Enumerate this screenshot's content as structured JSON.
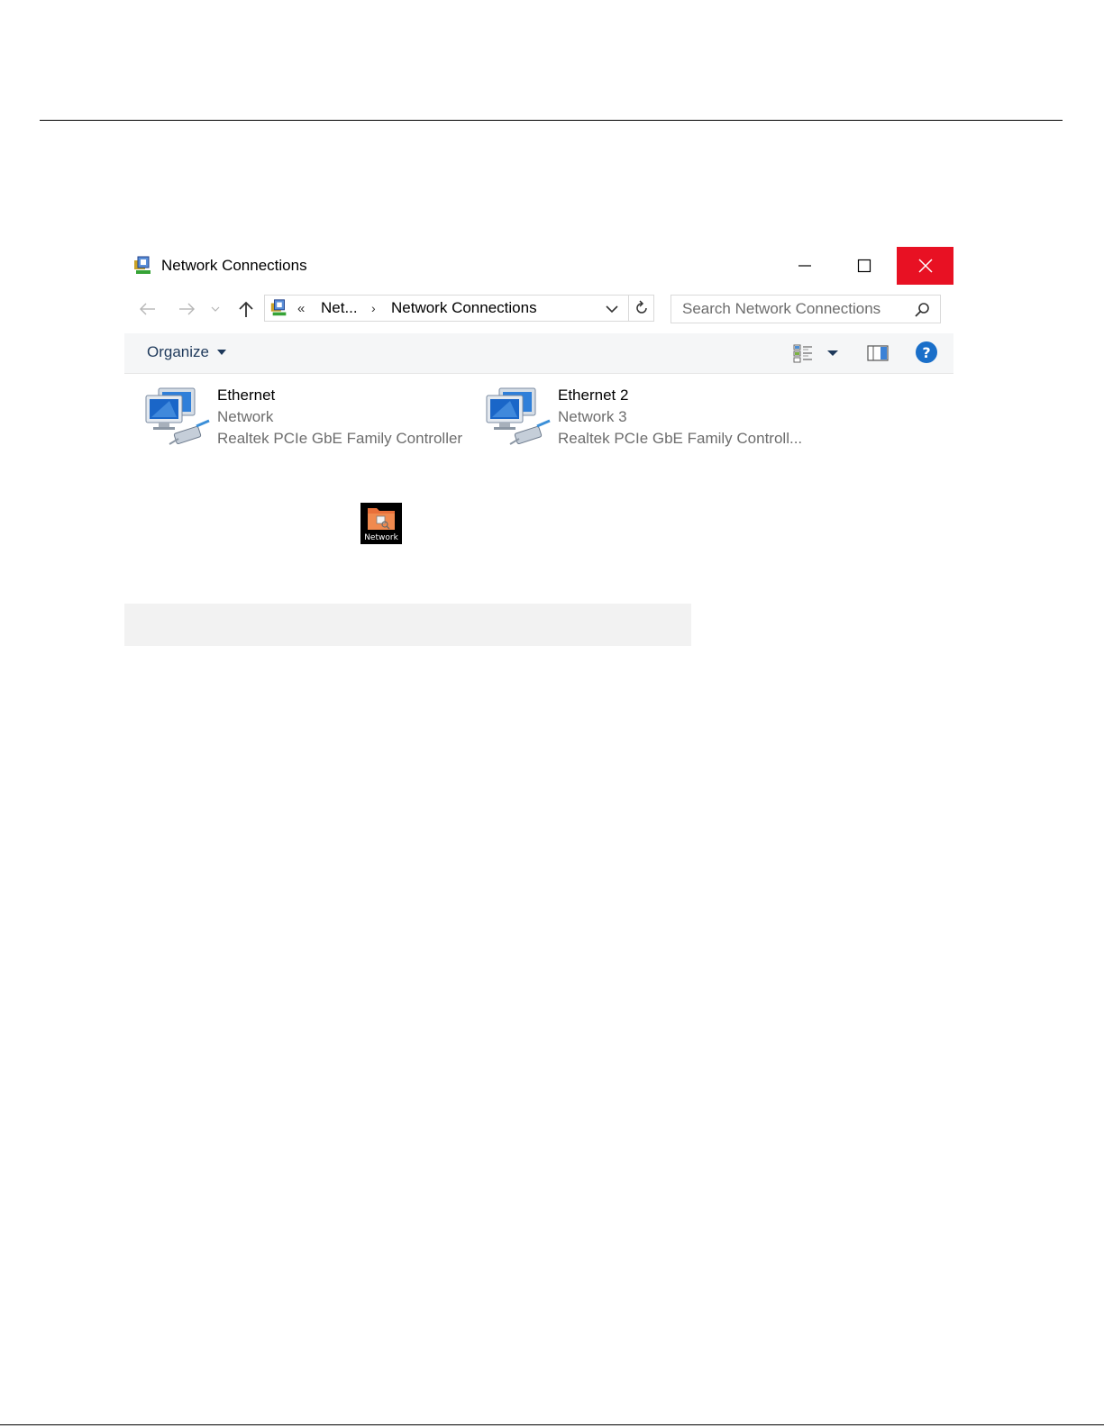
{
  "window": {
    "title": "Network Connections"
  },
  "address_bar": {
    "overflow": "«",
    "segment_1": "Net...",
    "separator": "›",
    "segment_2": "Network Connections"
  },
  "search": {
    "placeholder": "Search Network Connections"
  },
  "command_bar": {
    "organize_label": "Organize"
  },
  "connections": [
    {
      "name": "Ethernet",
      "network": "Network",
      "device": "Realtek PCIe GbE Family Controller"
    },
    {
      "name": "Ethernet 2",
      "network": "Network  3",
      "device": "Realtek PCIe GbE Family Controll..."
    }
  ],
  "network_logo": {
    "label": "Network"
  },
  "colors": {
    "close_button": "#e81123",
    "help_icon": "#1a6fc9",
    "organize_text": "#1e395b"
  }
}
